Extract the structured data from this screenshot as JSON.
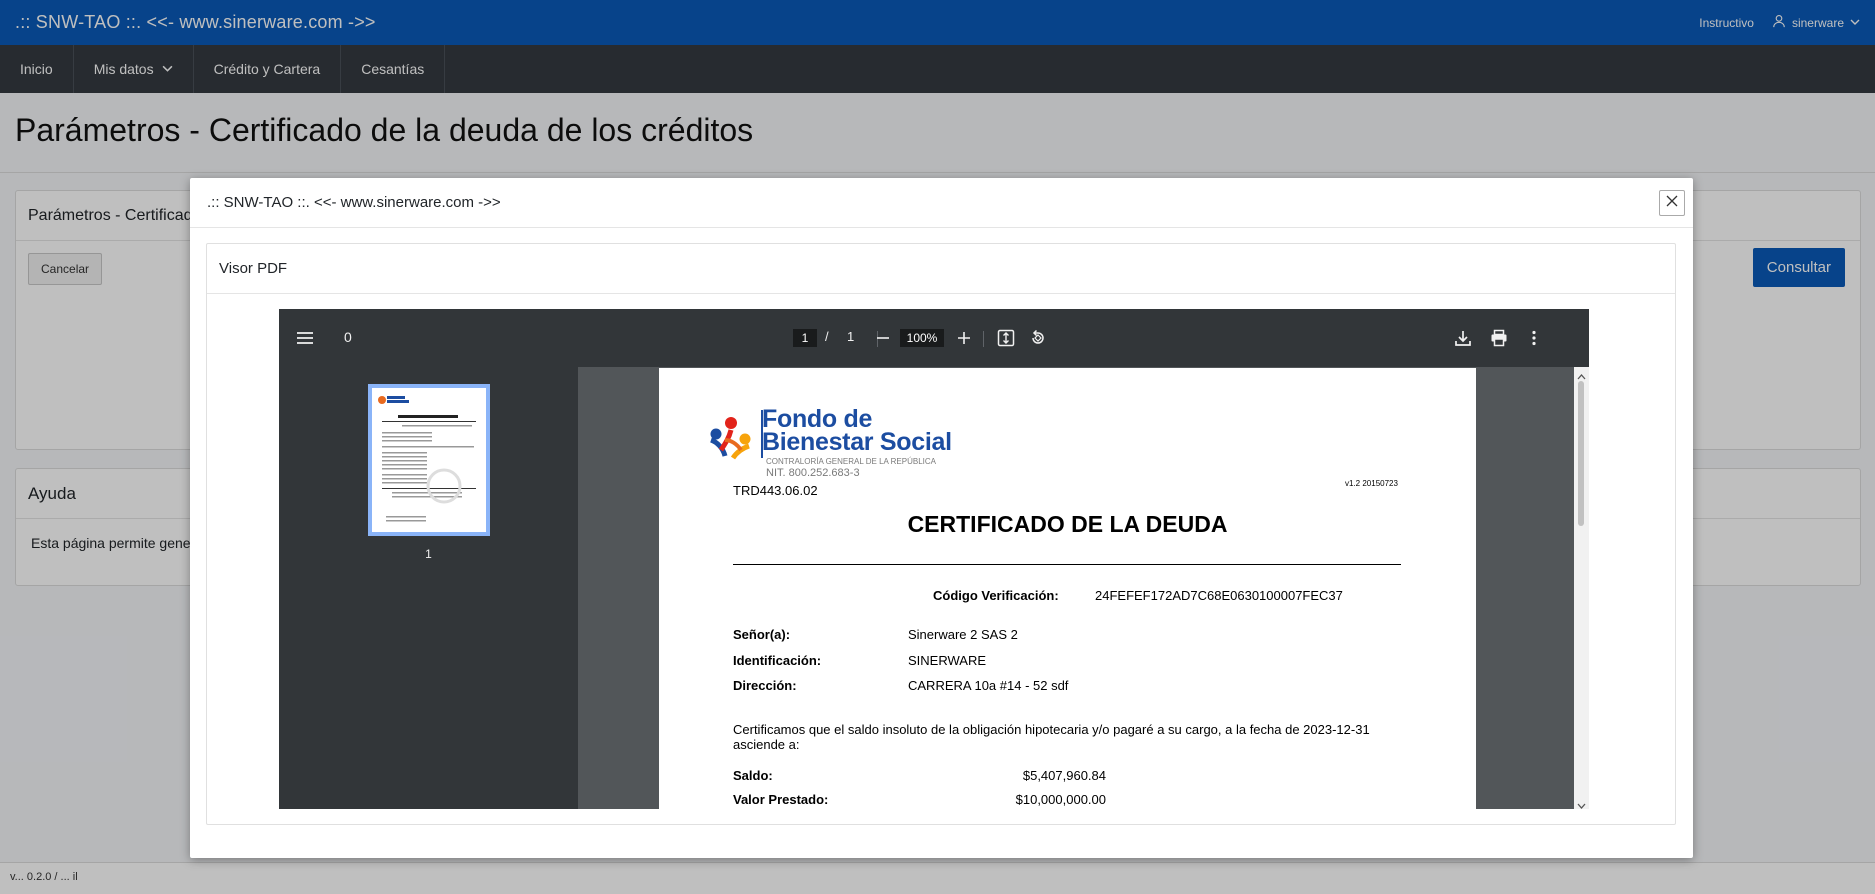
{
  "topbar": {
    "brand": ".:: SNW-TAO ::. <<- www.sinerware.com ->>",
    "instructivo": "Instructivo",
    "username": "sinerware"
  },
  "nav": {
    "items": [
      "Inicio",
      "Mis datos",
      "Crédito y Cartera",
      "Cesantías"
    ]
  },
  "page": {
    "title": "Parámetros - Certificado de la deuda de los créditos",
    "param_card_title": "Parámetros - Certificado",
    "cancel_label": "Cancelar",
    "consult_label": "Consultar",
    "help_title": "Ayuda",
    "help_text": "Esta página permite gener"
  },
  "footer": {
    "text": "v... 0.2.0 / ... il"
  },
  "modal": {
    "title": ".:: SNW-TAO ::. <<- www.sinerware.com ->>",
    "viewer_title": "Visor PDF"
  },
  "pdf": {
    "doc_title": "0",
    "page_current": "1",
    "page_sep": "/",
    "page_total": "1",
    "zoom": "100%",
    "thumb_label": "1",
    "icons": [
      "menu-icon",
      "zoom-out-icon",
      "zoom-in-icon",
      "fit-page-icon",
      "rotate-icon",
      "download-icon",
      "print-icon",
      "more-icon"
    ]
  },
  "certificate": {
    "logo_line1": "Fondo de",
    "logo_line2": "Bienestar Social",
    "logo_sub": "CONTRALORÍA GENERAL DE LA REPÚBLICA",
    "nit": "NIT. 800.252.683-3",
    "trd": "TRD443.06.02",
    "version": "v1.2 20150723",
    "title": "CERTIFICADO DE LA DEUDA",
    "verif_label": "Código Verificación:",
    "verif_value": "24FEFEF172AD7C68E0630100007FEC37",
    "senor_label": "Señor(a):",
    "senor_value": "Sinerware 2 SAS 2",
    "ident_label": "Identificación:",
    "ident_value": "SINERWARE",
    "dir_label": "Dirección:",
    "dir_value": "CARRERA 10a #14 - 52 sdf",
    "paragraph": "Certificamos que el saldo insoluto de la obligación hipotecaria y/o pagaré a su cargo, a la fecha de 2023-12-31 asciende a:",
    "saldo_label": "Saldo:",
    "saldo_value": "$5,407,960.84",
    "prestado_label": "Valor Prestado:",
    "prestado_value": "$10,000,000.00"
  },
  "colors": {
    "primary": "#0a5ab8",
    "navbar": "#343a40",
    "pdf_toolbar": "#323639",
    "pdf_bg": "#525659",
    "logo_blue": "#1c4da1"
  }
}
